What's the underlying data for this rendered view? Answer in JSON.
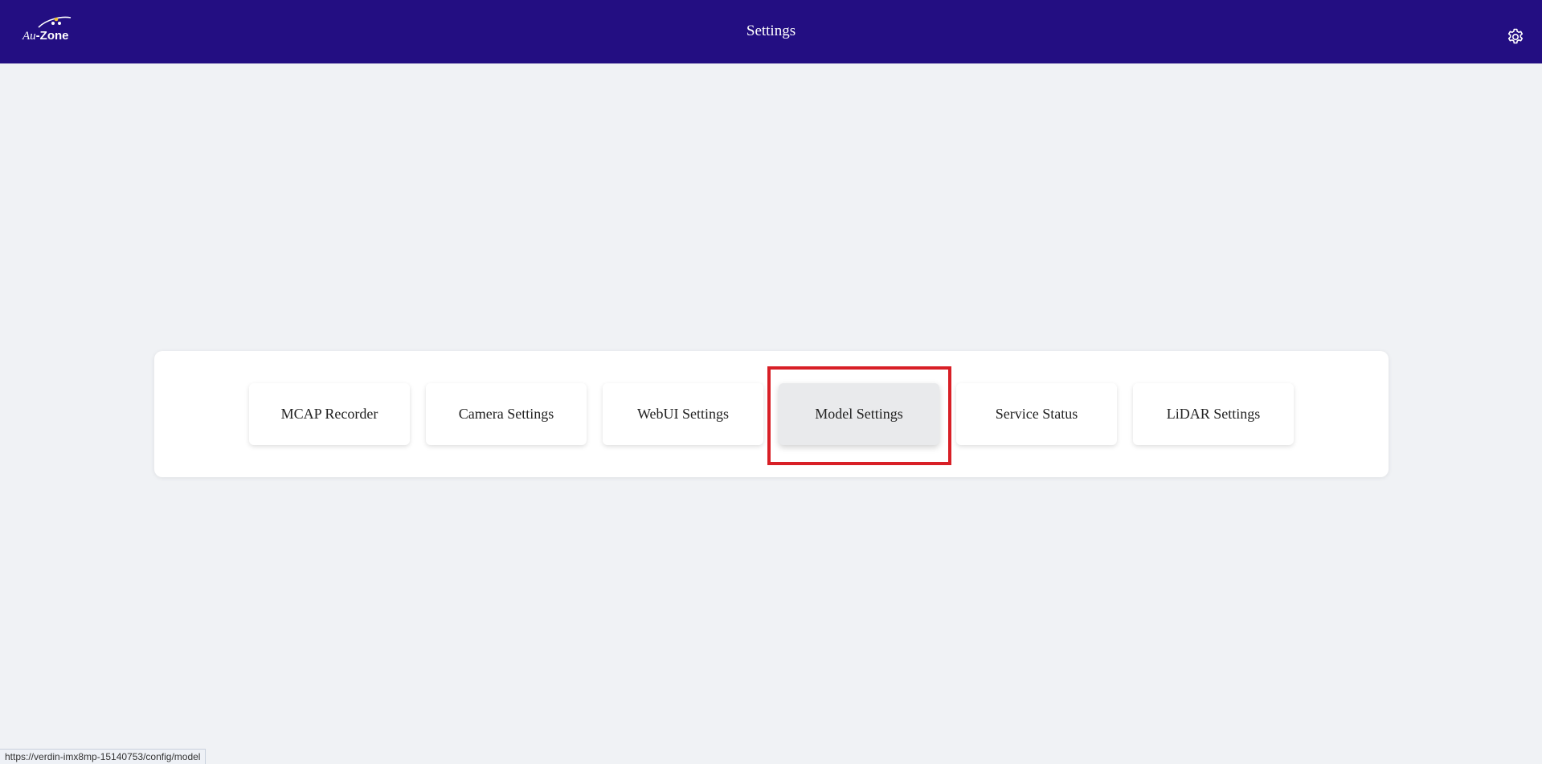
{
  "header": {
    "logo_prefix": "Au",
    "logo_name": "-Zone",
    "title": "Settings",
    "settings_icon": "gear-icon",
    "background_color": "#230e82"
  },
  "cards": [
    {
      "label": "MCAP Recorder"
    },
    {
      "label": "Camera Settings"
    },
    {
      "label": "WebUI Settings"
    },
    {
      "label": "Model Settings",
      "state": "hovered"
    },
    {
      "label": "Service Status"
    },
    {
      "label": "LiDAR Settings"
    }
  ],
  "highlight_color": "#d81f26",
  "status_url": "https://verdin-imx8mp-15140753/config/model"
}
